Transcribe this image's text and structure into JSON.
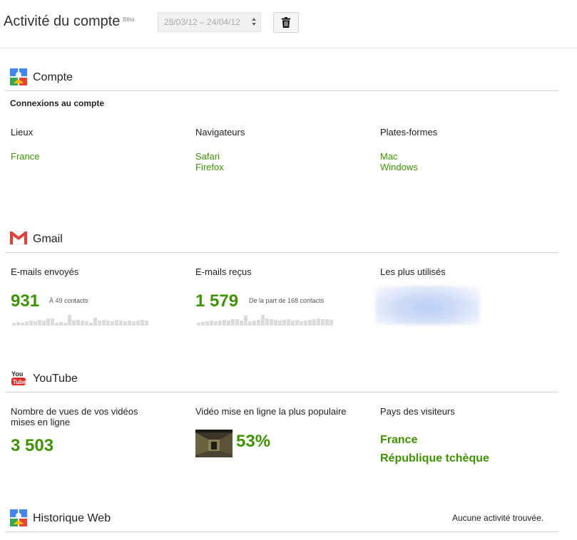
{
  "header": {
    "title": "Activité du compte",
    "beta": "Bêta",
    "date_range": "28/03/12 – 24/04/12"
  },
  "account": {
    "title": "Compte",
    "subheading": "Connexions au compte",
    "columns": [
      {
        "label": "Lieux",
        "items": [
          "France"
        ]
      },
      {
        "label": "Navigateurs",
        "items": [
          "Safari",
          "Firefox"
        ]
      },
      {
        "label": "Plates-formes",
        "items": [
          "Mac",
          "Windows"
        ]
      }
    ]
  },
  "gmail": {
    "title": "Gmail",
    "sent": {
      "label": "E-mails envoyés",
      "count": "931",
      "note": "À 49 contacts"
    },
    "received": {
      "label": "E-mails reçus",
      "count": "1 579",
      "note": "De la part de 168 contacts"
    },
    "most_used": {
      "label": "Les plus utilisés"
    }
  },
  "youtube": {
    "title": "YouTube",
    "views": {
      "label": "Nombre de vues de vos vidéos mises en ligne",
      "count": "3 503"
    },
    "popular": {
      "label": "Vidéo mise en ligne la plus populaire",
      "percent": "53%"
    },
    "countries": {
      "label": "Pays des visiteurs",
      "items": [
        "France",
        "République tchèque"
      ]
    }
  },
  "web_history": {
    "title": "Historique Web",
    "status": "Aucune activité trouvée."
  },
  "colors": {
    "accent_green": "#3d9400",
    "divider": "#d2d2d2"
  },
  "icons": {
    "date_picker": "updown-arrows-icon",
    "delete": "trash-icon",
    "account": "google-account-icon",
    "gmail": "gmail-icon",
    "youtube": "youtube-icon",
    "web_history": "google-account-icon"
  }
}
